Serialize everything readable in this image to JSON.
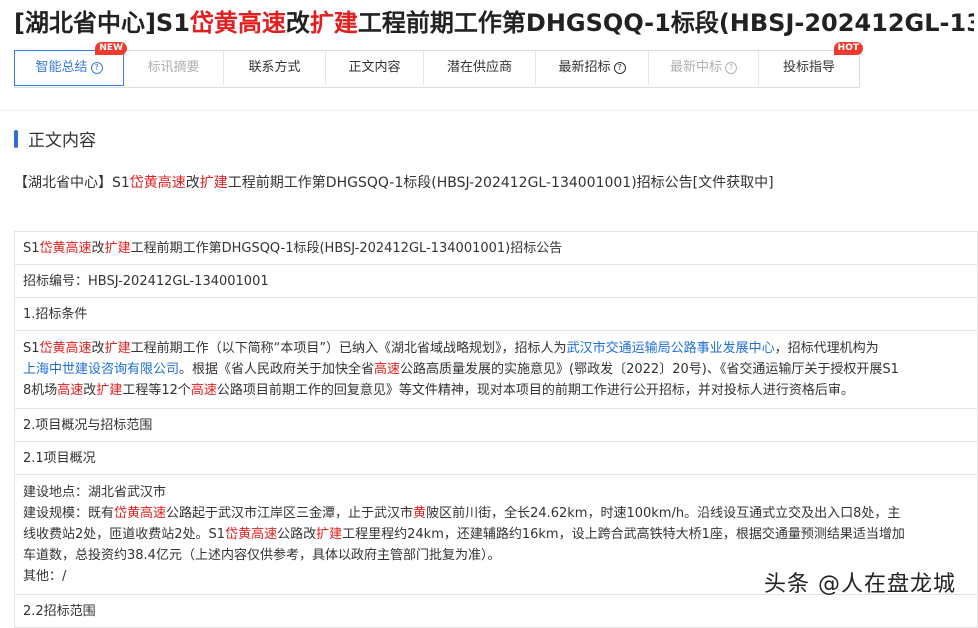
{
  "header": {
    "title_parts": [
      {
        "t": "[湖北省中心]S1",
        "c": ""
      },
      {
        "t": "岱黄高速",
        "c": "hl"
      },
      {
        "t": "改",
        "c": ""
      },
      {
        "t": "扩建",
        "c": "hl"
      },
      {
        "t": "工程前期工作第DHGSQQ-1标段(HBSJ-202412GL-13...",
        "c": ""
      }
    ]
  },
  "tabs": [
    {
      "label": "智能总结",
      "help": "?",
      "badge": "NEW",
      "state": "active",
      "w": 110
    },
    {
      "label": "标讯摘要",
      "help": "",
      "badge": "",
      "state": "disabled",
      "w": 100
    },
    {
      "label": "联系方式",
      "help": "",
      "badge": "",
      "state": "",
      "w": 102
    },
    {
      "label": "正文内容",
      "help": "",
      "badge": "",
      "state": "",
      "w": 98
    },
    {
      "label": "潜在供应商",
      "help": "",
      "badge": "",
      "state": "",
      "w": 112
    },
    {
      "label": "最新招标",
      "help": "?",
      "badge": "",
      "state": "",
      "w": 113
    },
    {
      "label": "最新中标",
      "help": "?",
      "badge": "",
      "state": "disabled",
      "w": 110
    },
    {
      "label": "投标指导",
      "help": "",
      "badge": "HOT",
      "state": "",
      "w": 100
    }
  ],
  "section": {
    "title": "正文内容"
  },
  "subject_parts": [
    {
      "t": "【湖北省中心】S1",
      "c": ""
    },
    {
      "t": "岱黄高速",
      "c": "hl"
    },
    {
      "t": "改",
      "c": ""
    },
    {
      "t": "扩建",
      "c": "hl"
    },
    {
      "t": "工程前期工作第DHGSQQ-1标段(HBSJ-202412GL-134001001)招标公告[文件获取中]",
      "c": ""
    }
  ],
  "table_rows": [
    {
      "type": "single",
      "lines": [
        [
          {
            "t": "S1",
            "c": ""
          },
          {
            "t": "岱黄高速",
            "c": "hl"
          },
          {
            "t": "改",
            "c": ""
          },
          {
            "t": "扩建",
            "c": "hl"
          },
          {
            "t": "工程前期工作第DHGSQQ-1标段(HBSJ-202412GL-134001001)招标公告",
            "c": ""
          }
        ]
      ]
    },
    {
      "type": "single",
      "lines": [
        [
          {
            "t": "招标编号：HBSJ-202412GL-134001001",
            "c": ""
          }
        ]
      ]
    },
    {
      "type": "single",
      "lines": [
        [
          {
            "t": "1.招标条件",
            "c": ""
          }
        ]
      ]
    },
    {
      "type": "multi",
      "lines": [
        [
          {
            "t": "S1",
            "c": ""
          },
          {
            "t": "岱黄高速",
            "c": "hl"
          },
          {
            "t": "改",
            "c": ""
          },
          {
            "t": "扩建",
            "c": "hl"
          },
          {
            "t": "工程前期工作（以下简称“本项目”）已纳入《湖北省域战略规划》，招标人为",
            "c": ""
          },
          {
            "t": "武汉市交通运输局公路事业发展中心",
            "c": "lk"
          },
          {
            "t": "，招标代理机构为",
            "c": ""
          }
        ],
        [
          {
            "t": "上海中世建设咨询有限公司",
            "c": "lk"
          },
          {
            "t": "。根据《省人民政府关于加快全省",
            "c": ""
          },
          {
            "t": "高速",
            "c": "hl"
          },
          {
            "t": "公路高质量发展的实施意见》(鄂政发〔2022〕20号)、《省交通运输厅关于授权开展S1",
            "c": ""
          }
        ],
        [
          {
            "t": "8机场",
            "c": ""
          },
          {
            "t": "高速",
            "c": "hl"
          },
          {
            "t": "改",
            "c": ""
          },
          {
            "t": "扩建",
            "c": "hl"
          },
          {
            "t": "工程等12个",
            "c": ""
          },
          {
            "t": "高速",
            "c": "hl"
          },
          {
            "t": "公路项目前期工作的回复意见》等文件精神，现对本项目的前期工作进行公开招标，并对投标人进行资格后审。",
            "c": ""
          }
        ]
      ]
    },
    {
      "type": "single",
      "lines": [
        [
          {
            "t": "2.项目概况与招标范围",
            "c": ""
          }
        ]
      ]
    },
    {
      "type": "single",
      "lines": [
        [
          {
            "t": "2.1项目概况",
            "c": ""
          }
        ]
      ]
    },
    {
      "type": "multi",
      "lines": [
        [
          {
            "t": "建设地点：湖北省武汉市",
            "c": ""
          }
        ],
        [
          {
            "t": "建设规模：既有",
            "c": ""
          },
          {
            "t": "岱黄高速",
            "c": "hl"
          },
          {
            "t": "公路起于武汉市江岸区三金潭，止于武汉市",
            "c": ""
          },
          {
            "t": "黄",
            "c": "hl"
          },
          {
            "t": "陂区前川街，全长24.62km，时速100km/h。沿线设互通式立交及出入口8处，主",
            "c": ""
          }
        ],
        [
          {
            "t": "线收费站2处，匝道收费站2处。S1",
            "c": ""
          },
          {
            "t": "岱黄高速",
            "c": "hl"
          },
          {
            "t": "公路改",
            "c": ""
          },
          {
            "t": "扩建",
            "c": "hl"
          },
          {
            "t": "工程里程约24km，还建辅路约16km，设上跨合武高铁特大桥1座，根据交通量预测结果适当增加",
            "c": ""
          }
        ],
        [
          {
            "t": "车道数，总投资约38.4亿元（上述内容仅供参考，具体以政府主管部门批复为准）。",
            "c": ""
          }
        ],
        [
          {
            "t": "其他：/",
            "c": ""
          }
        ]
      ]
    },
    {
      "type": "single",
      "lines": [
        [
          {
            "t": "2.2招标范围",
            "c": ""
          }
        ]
      ]
    }
  ],
  "watermark": "头条 @人在盘龙城"
}
